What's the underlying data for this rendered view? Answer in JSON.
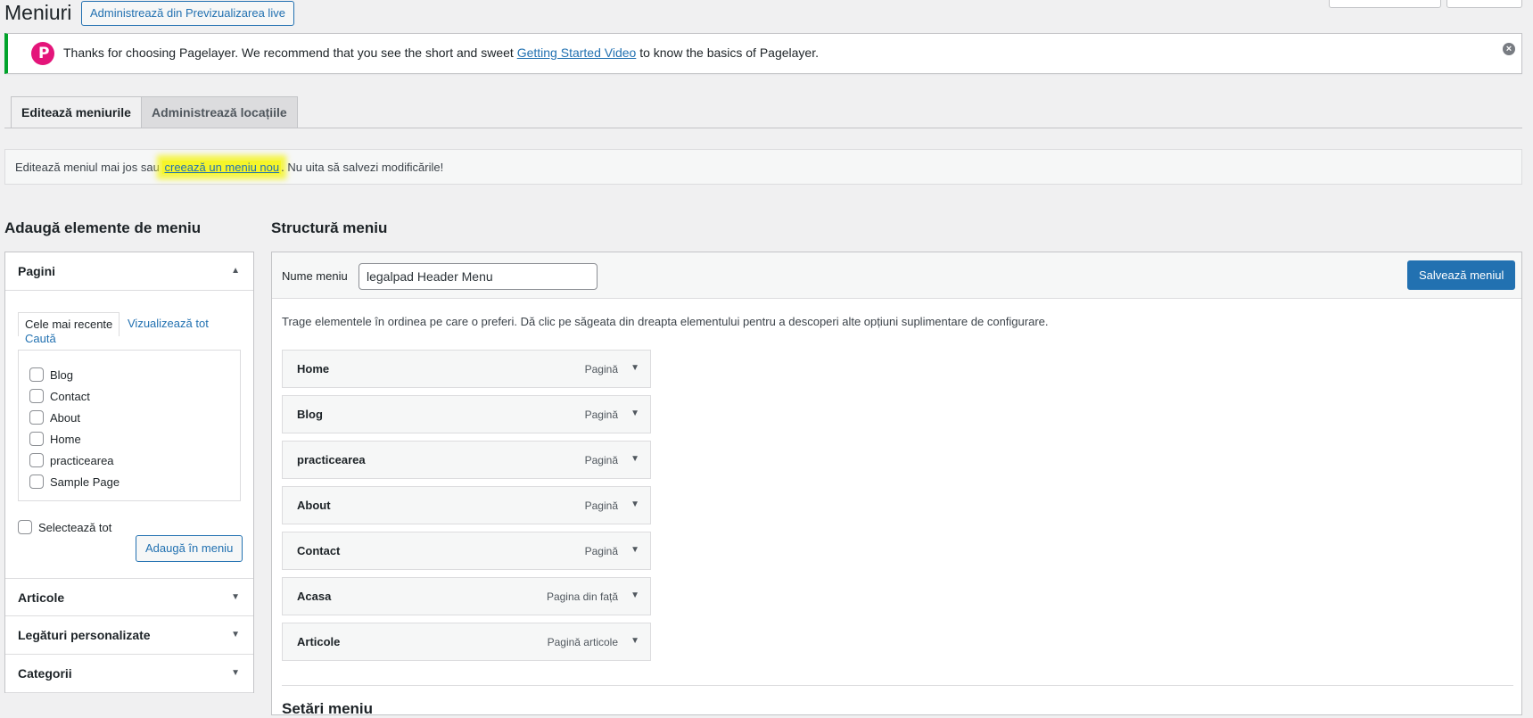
{
  "header": {
    "title": "Meniuri",
    "live_button": "Administrează din Previzualizarea live"
  },
  "notice": {
    "text_before": "Thanks for choosing Pagelayer. We recommend that you see the short and sweet ",
    "link": "Getting Started Video",
    "text_after": " to know the basics of Pagelayer.",
    "logo_letter": "P",
    "dismiss": "×",
    "accent_color": "#00a32a",
    "logo_color": "#e4157a"
  },
  "tabs": [
    {
      "label": "Editează meniurile",
      "active": true
    },
    {
      "label": "Administrează locațiile",
      "active": false
    }
  ],
  "manage_bar": {
    "text_before": "Editează meniul mai jos sau ",
    "link": "creează un meniu nou",
    "text_after": ". Nu uita să salvezi modificările!",
    "highlight_color": "#f5f52a"
  },
  "left": {
    "title": "Adaugă elemente de meniu",
    "pages_section": {
      "label": "Pagini",
      "subtabs": {
        "recent": "Cele mai recente",
        "all": "Vizualizează tot",
        "search": "Caută"
      },
      "items": [
        "Blog",
        "Contact",
        "About",
        "Home",
        "practicearea",
        "Sample Page"
      ],
      "select_all": "Selectează tot",
      "add_button": "Adaugă în meniu"
    },
    "other_sections": [
      "Articole",
      "Legături personalizate",
      "Categorii"
    ]
  },
  "right": {
    "title": "Structură meniu",
    "menu_name_label": "Nume meniu",
    "menu_name_value": "legalpad Header Menu",
    "save_button": "Salvează meniul",
    "drag_hint": "Trage elementele în ordinea pe care o preferi. Dă clic pe săgeata din dreapta elementului pentru a descoperi alte opțiuni suplimentare de configurare.",
    "items": [
      {
        "title": "Home",
        "type": "Pagină"
      },
      {
        "title": "Blog",
        "type": "Pagină"
      },
      {
        "title": "practicearea",
        "type": "Pagină"
      },
      {
        "title": "About",
        "type": "Pagină"
      },
      {
        "title": "Contact",
        "type": "Pagină"
      },
      {
        "title": "Acasa",
        "type": "Pagina din față"
      },
      {
        "title": "Articole",
        "type": "Pagină articole"
      }
    ],
    "settings_title": "Setări meniu"
  },
  "icons": {
    "expand": "▲",
    "collapse": "▼",
    "item_toggle": "▼"
  },
  "colors": {
    "primary": "#2271b1",
    "background": "#f0f0f1"
  }
}
